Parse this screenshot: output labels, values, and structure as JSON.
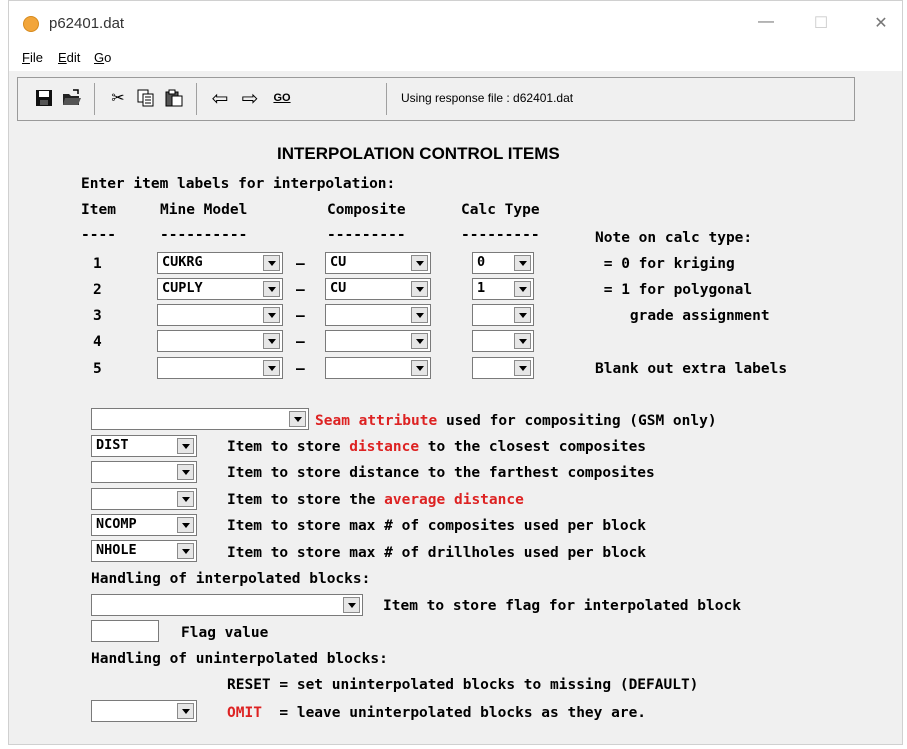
{
  "window": {
    "title": "p62401.dat",
    "min_glyph": "—",
    "max_glyph": "☐",
    "close_glyph": "✕"
  },
  "menu": [
    {
      "label": "File",
      "mnemonic": "F",
      "rest": "ile"
    },
    {
      "label": "Edit",
      "mnemonic": "E",
      "rest": "dit"
    },
    {
      "label": "Go",
      "mnemonic": "G",
      "rest": "o"
    }
  ],
  "toolbar": {
    "icons": [
      "save-icon",
      "open-icon",
      "cut-icon",
      "copy-icon",
      "paste-icon",
      "back-arrow-icon",
      "forward-arrow-icon",
      "go-icon"
    ],
    "glyphs": {
      "save": "▪",
      "open": "▤",
      "cut": "✂",
      "copy": "⧉",
      "paste": "📋",
      "back": "⇦",
      "forward": "⇨",
      "go": "GO"
    },
    "status": "Using response file : d62401.dat"
  },
  "form": {
    "heading": "INTERPOLATION CONTROL ITEMS",
    "prompt": "Enter item labels for interpolation:",
    "col_item": "Item",
    "col_model": "Mine Model",
    "col_composite": "Composite",
    "col_calc": "Calc Type",
    "dash_item": "----",
    "dash_model": "----------",
    "dash_composite": "---------",
    "dash_calc": "---------",
    "row_sep": "–",
    "rows": [
      {
        "item": "1",
        "model": "CUKRG",
        "composite": "CU",
        "calc": "0"
      },
      {
        "item": "2",
        "model": "CUPLY",
        "composite": "CU",
        "calc": "1"
      },
      {
        "item": "3",
        "model": "",
        "composite": "",
        "calc": ""
      },
      {
        "item": "4",
        "model": "",
        "composite": "",
        "calc": ""
      },
      {
        "item": "5",
        "model": "",
        "composite": "",
        "calc": ""
      }
    ],
    "notes": {
      "n1": "Note on calc type:",
      "n2": " = 0 for kriging",
      "n3": " = 1 for polygonal",
      "n4": "    grade assignment",
      "n5": "Blank out extra labels"
    },
    "seam": {
      "value": "",
      "red": "Seam attribute",
      "rest": " used for compositing (GSM only)"
    },
    "dist_closest": {
      "value": "DIST",
      "pre": "Item to store ",
      "red": "distance",
      "post": " to the closest composites"
    },
    "dist_farthest": {
      "value": "",
      "text": "Item to store distance to the farthest composites"
    },
    "avg_dist": {
      "value": "",
      "pre": "Item to store the ",
      "red": "average distance"
    },
    "ncomp": {
      "value": "NCOMP",
      "text": "Item to store max # of composites used per block"
    },
    "nhole": {
      "value": "NHOLE",
      "text": "Item to store max # of drillholes used per block"
    },
    "interp_heading": "Handling of interpolated blocks:",
    "interp_flag": {
      "value": "",
      "text": "Item to store flag for interpolated block"
    },
    "flag_value": {
      "value": "",
      "label": "Flag value"
    },
    "uninterp_heading": "Handling of uninterpolated blocks:",
    "reset_line": "RESET = set uninterpolated blocks to missing (DEFAULT)",
    "omit": {
      "value": "",
      "red": "OMIT",
      "rest": "  = leave uninterpolated blocks as they are."
    }
  }
}
